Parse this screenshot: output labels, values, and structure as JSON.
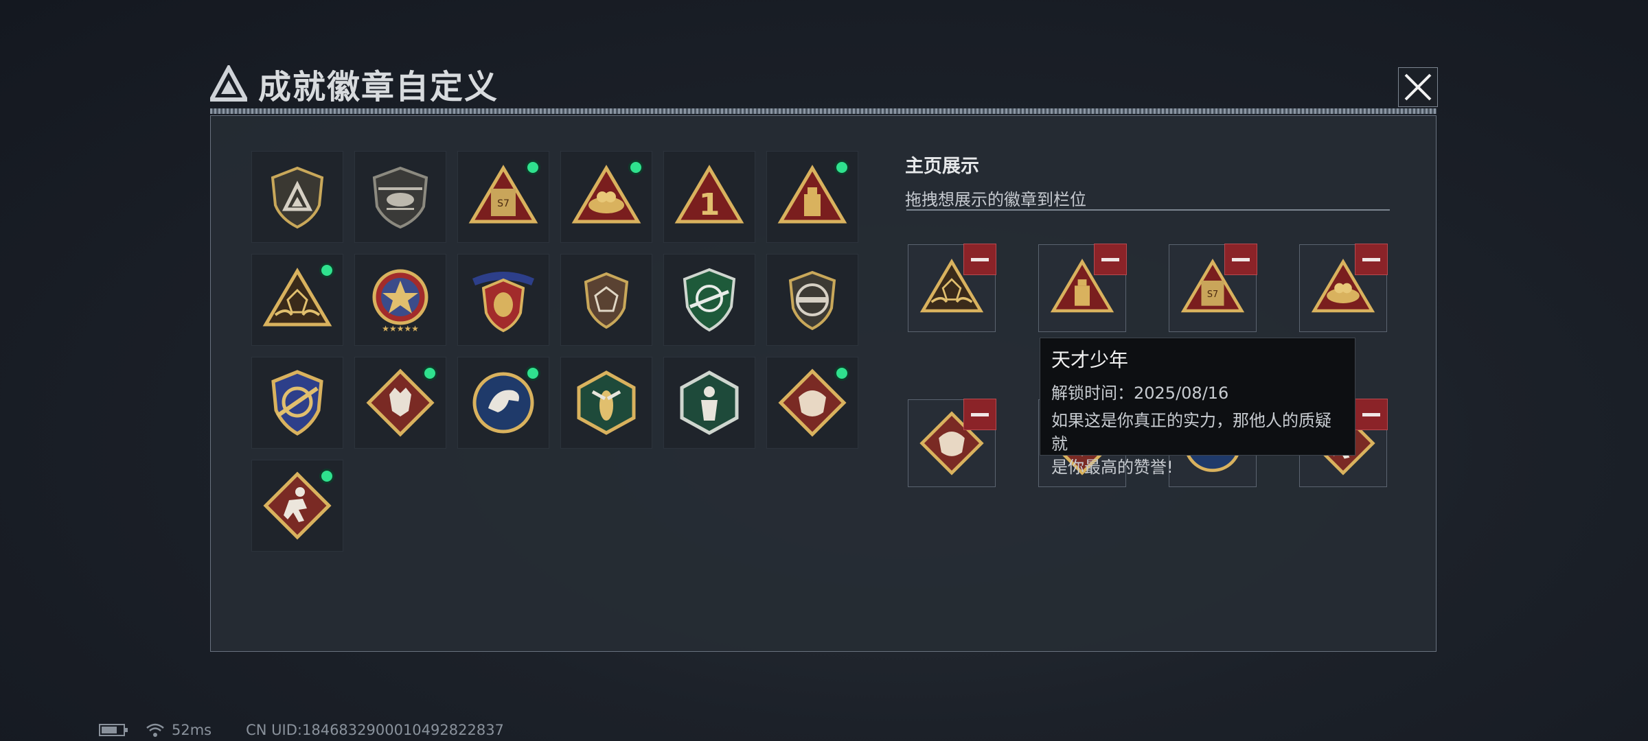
{
  "header": {
    "title": "成就徽章自定义"
  },
  "showcase": {
    "title": "主页展示",
    "subtitle": "拖拽想展示的徽章到栏位"
  },
  "tooltip": {
    "name": "天才少年",
    "unlock_time": "解锁时间：2025/08/16",
    "description_line1": "如果这是你真正的实力，那他人的质疑就",
    "description_line2": "是你最高的赞誉!"
  },
  "badge_labels": {
    "b3": "S7",
    "b5": "1",
    "s3": "S7"
  },
  "status": {
    "ping": "52ms",
    "uid": "CN UID:1846832900010492822837"
  },
  "colors": {
    "new_dot": "#2fe28e",
    "remove": "#8b2328"
  }
}
